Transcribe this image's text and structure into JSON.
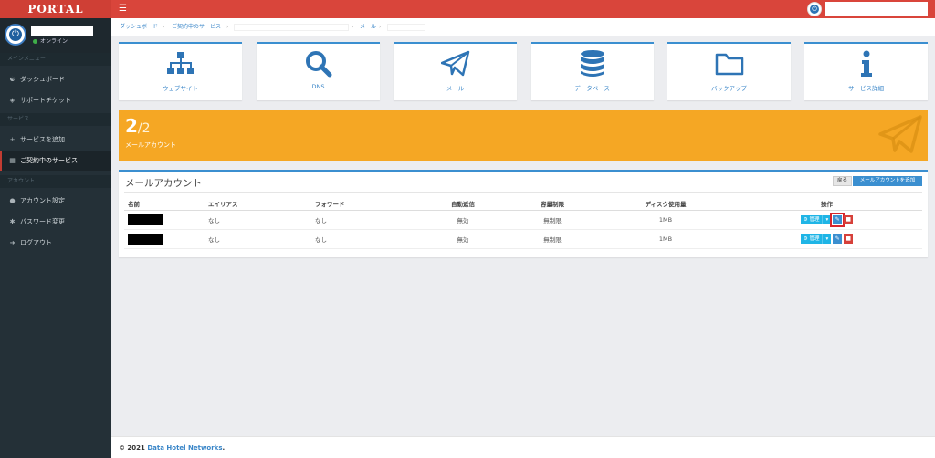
{
  "header": {
    "logo": "PORTAL",
    "menu_icon": "hamburger-icon",
    "power_icon": "power-icon"
  },
  "sidebar": {
    "status": "オンライン",
    "sections": [
      "メインメニュー",
      "サービス",
      "アカウント"
    ],
    "items": [
      {
        "label": "ダッシュボード",
        "icon": "dashboard-icon"
      },
      {
        "label": "サポートチケット",
        "icon": "ticket-icon"
      },
      {
        "label": "サービスを追加",
        "icon": "plus-icon"
      },
      {
        "label": "ご契約中のサービス",
        "icon": "grid-icon",
        "active": true
      },
      {
        "label": "アカウント設定",
        "icon": "user-icon"
      },
      {
        "label": "パスワード変更",
        "icon": "asterisk-icon"
      },
      {
        "label": "ログアウト",
        "icon": "logout-icon"
      }
    ]
  },
  "breadcrumb": {
    "items": [
      "ダッシュボード",
      "ご契約中のサービス",
      "メール"
    ]
  },
  "tiles": [
    {
      "label": "ウェブサイト",
      "icon": "sitemap-icon"
    },
    {
      "label": "DNS",
      "icon": "search-icon"
    },
    {
      "label": "メール",
      "icon": "paper-plane-icon"
    },
    {
      "label": "データベース",
      "icon": "database-icon"
    },
    {
      "label": "バックアップ",
      "icon": "folder-icon"
    },
    {
      "label": "サービス詳細",
      "icon": "info-icon"
    }
  ],
  "banner": {
    "count": "2",
    "total": "/2",
    "label": "メールアカウント",
    "color": "#f5a724"
  },
  "panel": {
    "title": "メールアカウント",
    "back_label": "戻る",
    "add_label": "メールアカウントを追加",
    "columns": [
      "名前",
      "エイリアス",
      "フォワード",
      "自動返信",
      "容量制限",
      "ディスク使用量",
      "操作"
    ],
    "rows": [
      {
        "alias": "なし",
        "forward": "なし",
        "autoreply": "無効",
        "quota": "無制限",
        "disk": "1MB"
      },
      {
        "alias": "なし",
        "forward": "なし",
        "autoreply": "無効",
        "quota": "無制限",
        "disk": "1MB"
      }
    ],
    "manage_label": "管理",
    "highlight_color": "#d8262c"
  },
  "footer": {
    "prefix": "© 2021",
    "company": "Data Hotel Networks",
    "suffix": "."
  },
  "colors": {
    "accent": "#3b8fd0",
    "header": "#d9453b",
    "sidebar": "#243037"
  }
}
